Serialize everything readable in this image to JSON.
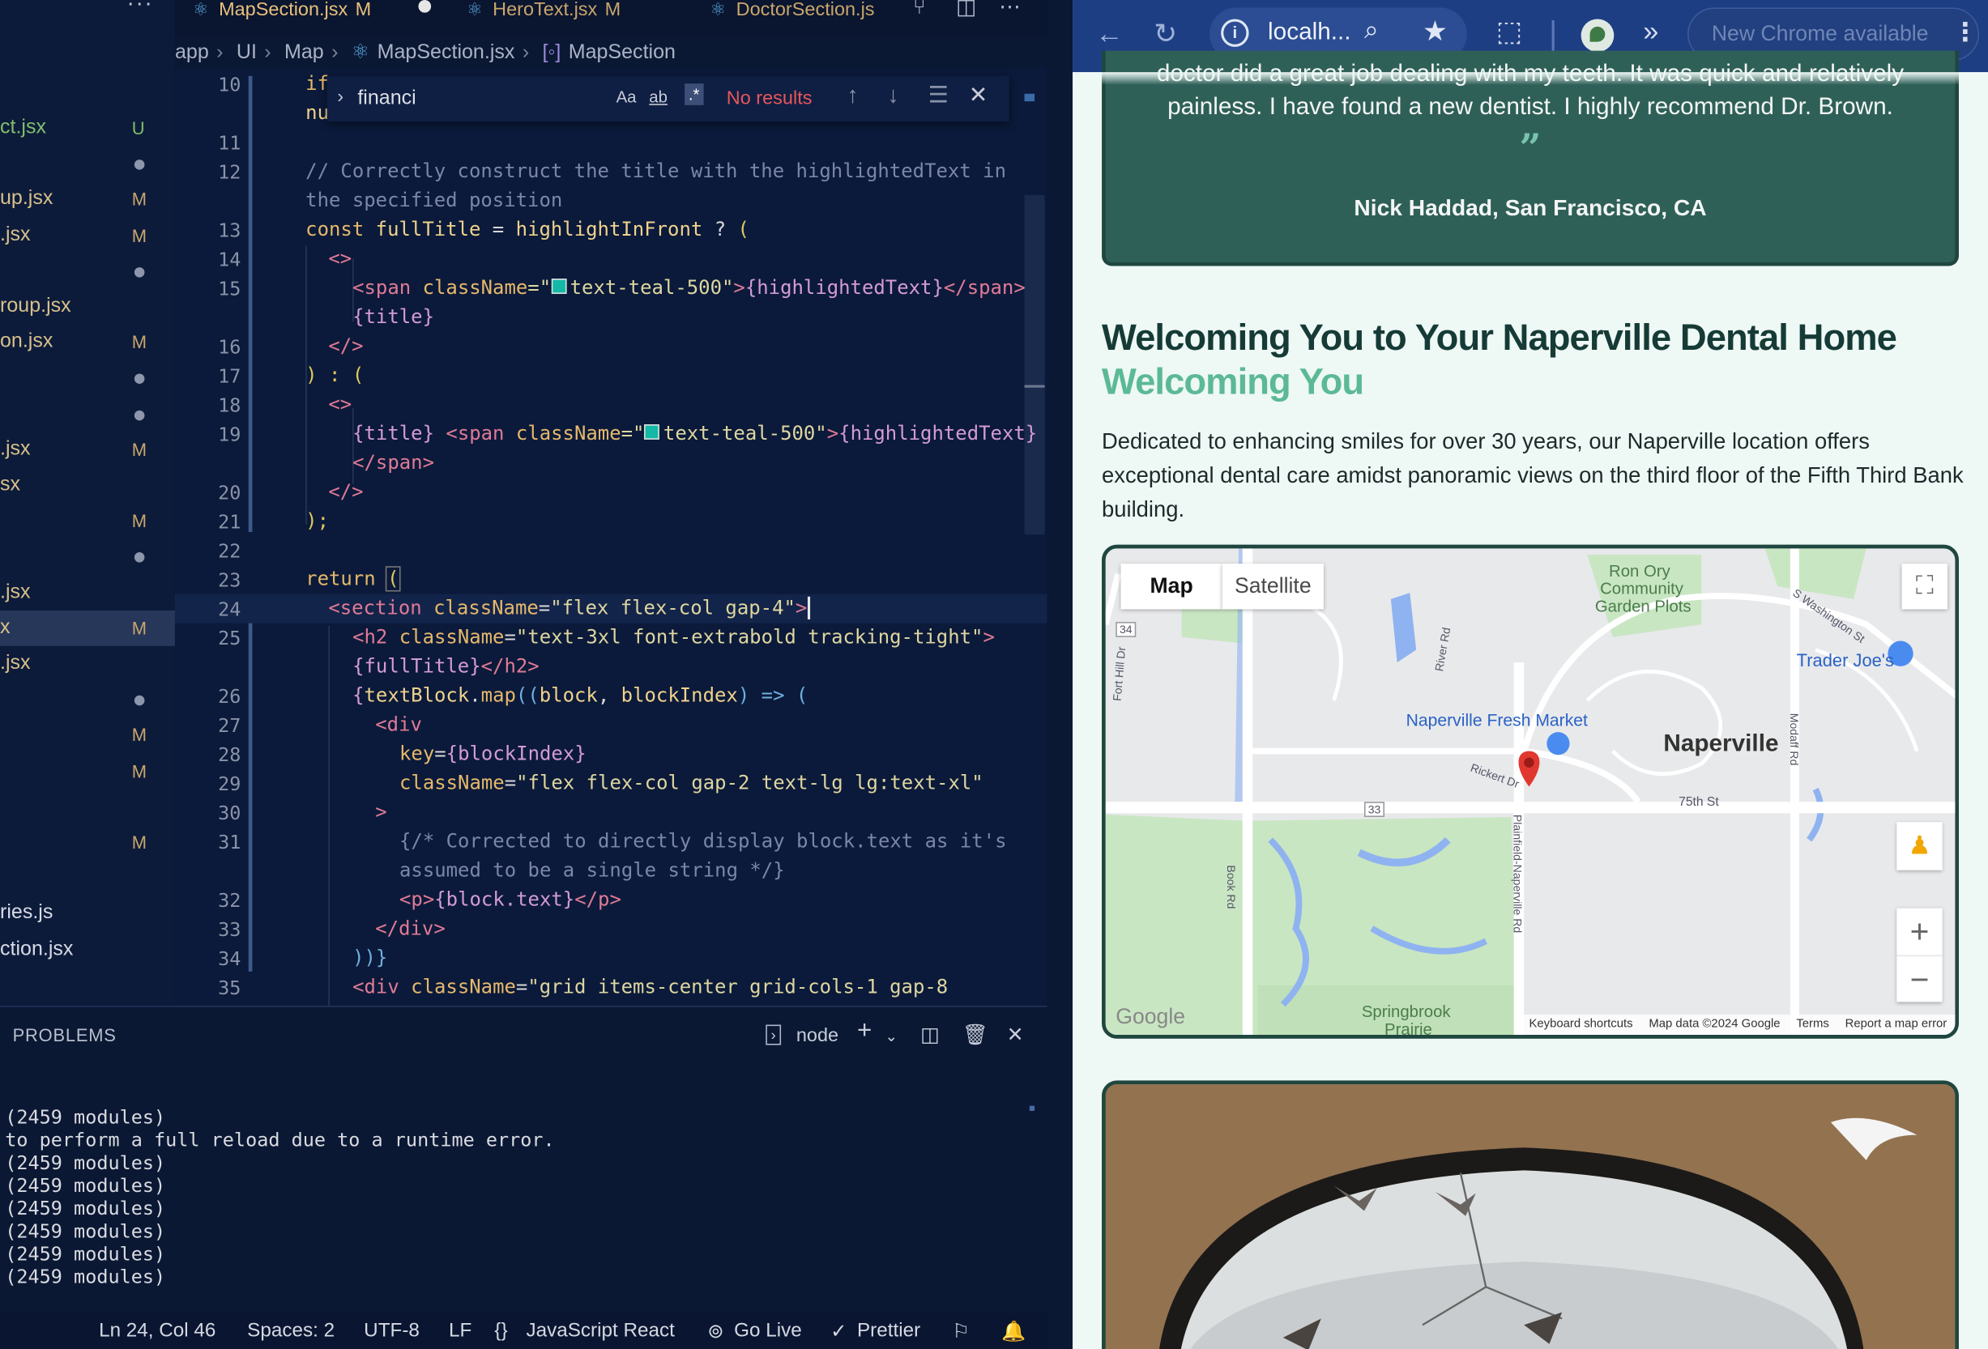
{
  "vscode": {
    "tabs": [
      {
        "label": "MapSection.jsx",
        "mod": "M"
      },
      {
        "label": "HeroText.jsx",
        "mod": "M"
      },
      {
        "label": "DoctorSection.js"
      }
    ],
    "breadcrumb": [
      "app",
      "UI",
      "Map",
      "MapSection.jsx",
      "MapSection"
    ],
    "explorer": [
      {
        "name": "ct.jsx",
        "badge": "U"
      },
      {
        "name": "",
        "badge": "dot"
      },
      {
        "name": "up.jsx",
        "badge": "M"
      },
      {
        "name": ".jsx",
        "badge": "M"
      },
      {
        "name": "",
        "badge": "dot"
      },
      {
        "name": "roup.jsx",
        "badge": ""
      },
      {
        "name": "on.jsx",
        "badge": "M"
      },
      {
        "name": "",
        "badge": "dot"
      },
      {
        "name": "",
        "badge": "dot"
      },
      {
        "name": ".jsx",
        "badge": "M"
      },
      {
        "name": "sx",
        "badge": ""
      },
      {
        "name": "",
        "badge": "M"
      },
      {
        "name": "",
        "badge": "dot"
      },
      {
        "name": ".jsx",
        "badge": ""
      },
      {
        "name": "x",
        "badge": "M"
      },
      {
        "name": ".jsx",
        "badge": ""
      },
      {
        "name": "",
        "badge": "dot"
      },
      {
        "name": "",
        "badge": "M"
      },
      {
        "name": "",
        "badge": "M"
      },
      {
        "name": "",
        "badge": ""
      },
      {
        "name": "",
        "badge": "M"
      },
      {
        "name": "",
        "badge": ""
      },
      {
        "name": "ries.js",
        "badge": ""
      },
      {
        "name": "ction.jsx",
        "badge": ""
      }
    ],
    "find": {
      "query": "financi",
      "case": "Aa",
      "word": "ab",
      "regex": ".*",
      "result": "No results"
    },
    "gutter": [
      "10",
      "",
      "11",
      "12",
      "",
      "13",
      "14",
      "15",
      "",
      "16",
      "17",
      "18",
      "19",
      "",
      "20",
      "21",
      "22",
      "23",
      "24",
      "25",
      "",
      "26",
      "27",
      "28",
      "29",
      "30",
      "31",
      "",
      "32",
      "33",
      "34",
      "35"
    ],
    "code": {
      "l10a": "if",
      "l10b": "nu",
      "l12a": "// Correctly construct the title with the highlightedText in",
      "l12b": "the specified position",
      "l13": [
        "const ",
        "fullTitle",
        " = ",
        "highlightInFront",
        " ? ",
        "("
      ],
      "l14": "<>",
      "l15a": [
        "<span ",
        "className",
        "=\"",
        "text-teal-500\"",
        ">",
        "{highlightedText}",
        "</span>"
      ],
      "l15b": "{title}",
      "l16": "</>",
      "l17": [
        ") : ",
        "("
      ],
      "l18": "<>",
      "l19a": [
        "{title} ",
        "<span ",
        "className",
        "=\"",
        "text-teal-500\"",
        ">",
        "{highlightedText}"
      ],
      "l19b": "</span>",
      "l20": "</>",
      "l21": ");",
      "l23": [
        "return ",
        "("
      ],
      "l24": [
        "<section ",
        "className",
        "=",
        "\"flex flex-col gap-4\"",
        ">"
      ],
      "l25a": [
        "<h2 ",
        "className",
        "=",
        "\"text-3xl font-extrabold tracking-tight\"",
        ">"
      ],
      "l25b": [
        "{fullTitle}",
        "</h2>"
      ],
      "l26": [
        "{",
        "textBlock",
        ".",
        "map",
        "((",
        "block",
        ", ",
        "blockIndex",
        ") => ("
      ],
      "l27": "<div",
      "l28": [
        "key",
        "=",
        "{blockIndex}"
      ],
      "l29": [
        "className",
        "=",
        "\"flex flex-col gap-2 text-lg lg:text-xl\""
      ],
      "l30": ">",
      "l31a": "{/* Corrected to directly display block.text as it's",
      "l31b": "assumed to be a single string */}",
      "l32": [
        "<p>",
        "{block.text}",
        "</p>"
      ],
      "l33": "</div>",
      "l34": "))}",
      "l35": [
        "<div ",
        "className",
        "=",
        "\"grid items-center grid-cols-1 gap-8"
      ]
    },
    "panel": {
      "title": "PROBLEMS",
      "terminal_name": "node",
      "lines": [
        "(2459 modules)",
        "to perform a full reload due to a runtime error.",
        "(2459 modules)",
        "(2459 modules)",
        "(2459 modules)",
        "(2459 modules)",
        "(2459 modules)",
        "(2459 modules)"
      ]
    },
    "status": {
      "position": "Ln 24, Col 46",
      "spaces": "Spaces: 2",
      "encoding": "UTF-8",
      "eol": "LF",
      "language": "JavaScript React",
      "golive": "Go Live",
      "prettier": "Prettier"
    }
  },
  "chrome": {
    "url": "localh...",
    "update": "New Chrome available",
    "testimonial": {
      "line1": "doctor did a great job dealing with my teeth. It was quick and relatively",
      "line2": "painless. I have found a new dentist. I highly recommend Dr. Brown.",
      "quote_mark": "”",
      "author": "Nick Haddad, San Francisco, CA"
    },
    "heading": "Welcoming You to Your Naperville Dental Home",
    "subheading": "Welcoming You",
    "paragraph": "Dedicated to enhancing smiles for over 30 years, our Naperville location offers exceptional dental care amidst panoramic views on the third floor of the Fifth Third Bank building.",
    "map": {
      "tab_map": "Map",
      "tab_satellite": "Satellite",
      "labels": {
        "ron_ory": "Ron Ory",
        "community": "Community",
        "garden": "Garden Plots",
        "trader": "Trader Joe's",
        "fresh": "Naperville Fresh Market",
        "city": "Naperville",
        "springbrook": "Springbrook",
        "prairie": "Prairie",
        "r75": "75th St",
        "r33": "33",
        "r34": "34",
        "river": "River Rd",
        "book": "Book Rd",
        "plainfield": "Plainfield-Naperville Rd",
        "rickert": "Rickert Dr",
        "fort": "Fort Hill Dr",
        "washington": "S Washington St",
        "modaff": "Modaff Rd"
      },
      "google": "Google",
      "footer": [
        "Keyboard shortcuts",
        "Map data ©2024 Google",
        "Terms",
        "Report a map error"
      ]
    }
  }
}
